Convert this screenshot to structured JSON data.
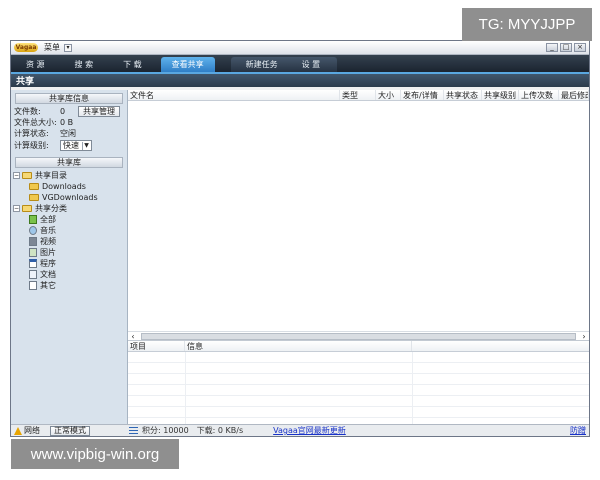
{
  "watermarks": {
    "top": "TG: MYYJJPP",
    "bottom": "www.vipbig-win.org"
  },
  "titlebar": {
    "logo": "Vagaa",
    "menu": "菜单",
    "menu_arrow": "▾",
    "buttons": [
      "_",
      "□",
      "×"
    ]
  },
  "nav": {
    "tabs": [
      {
        "label": "资 源"
      },
      {
        "label": "搜 索"
      },
      {
        "label": "下 载"
      },
      {
        "label": "查看共享",
        "active": true
      }
    ],
    "extra_tabs": [
      {
        "label": "新建任务"
      },
      {
        "label": "设 置"
      }
    ]
  },
  "section_title": "共享",
  "sidebar": {
    "library_header": "共享库信息",
    "file_count_label": "文件数:",
    "file_count_value": "0",
    "manage_button": "共享管理",
    "total_size_label": "文件总大小:",
    "total_size_value": "0 B",
    "calc_state_label": "计算状态:",
    "calc_state_value": "空闲",
    "calc_level_label": "计算级别:",
    "calc_level_value": "快速",
    "library_button": "共享库",
    "tree": {
      "dirs_label": "共享目录",
      "dirs": [
        "Downloads",
        "VGDownloads"
      ],
      "categories_label": "共享分类",
      "categories": [
        "全部",
        "音乐",
        "视频",
        "图片",
        "程序",
        "文档",
        "其它"
      ]
    }
  },
  "file_table": {
    "columns": [
      "文件名",
      "类型",
      "大小",
      "发布/详情",
      "共享状态",
      "共享级别",
      "上传次数",
      "最后修改"
    ]
  },
  "info_table": {
    "columns": [
      "项目",
      "信息"
    ]
  },
  "statusbar": {
    "network": "网络",
    "mode": "正常模式",
    "points": "积分: 10000",
    "download": "下载: 0 KB/s",
    "news_link": "Vagaa官网最新更新",
    "right_link": "防蹭"
  },
  "colors": {
    "nav_active": "#3f93dc",
    "nav_bg": "#202b38",
    "sidebar_bg": "#d8e2ec"
  }
}
